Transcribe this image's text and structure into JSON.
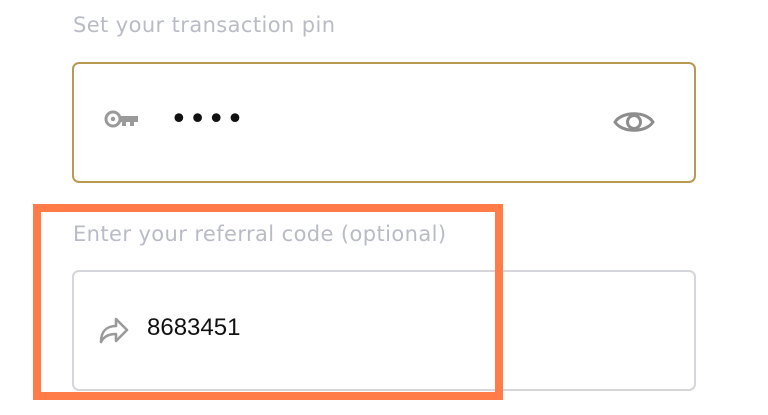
{
  "pin": {
    "label": "Set your transaction pin",
    "masked_value": "••••",
    "icon": "key-icon",
    "toggle_icon": "eye-icon",
    "border_color": "#b89a55"
  },
  "referral": {
    "label": "Enter your referral code (optional)",
    "value": "8683451",
    "icon": "share-arrow-icon",
    "border_color": "#d4d6dc"
  },
  "highlight_color": "#ff7b47"
}
